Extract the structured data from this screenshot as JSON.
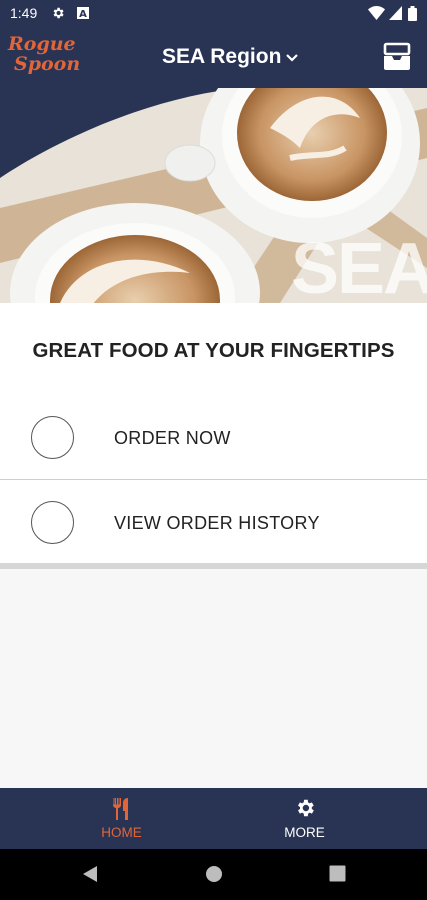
{
  "status_bar": {
    "time": "1:49",
    "icons": [
      "settings-icon",
      "text-a-icon",
      "wifi-icon",
      "signal-icon",
      "battery-icon"
    ]
  },
  "header": {
    "logo_line1": "Rogue",
    "logo_line2": "Spoon",
    "region": "SEA Region",
    "region_icon": "chevron-down-icon",
    "right_icon": "inbox-tray-icon"
  },
  "hero": {
    "overlay_text": "SEA"
  },
  "main": {
    "headline": "GREAT FOOD AT YOUR FINGERTIPS",
    "options": [
      {
        "label": "ORDER NOW"
      },
      {
        "label": "VIEW ORDER HISTORY"
      }
    ]
  },
  "bottom_nav": {
    "items": [
      {
        "label": "HOME",
        "icon": "fork-knife-icon",
        "active": true
      },
      {
        "label": "MORE",
        "icon": "gear-icon",
        "active": false
      }
    ]
  },
  "colors": {
    "navy": "#293353",
    "accent": "#e0663a",
    "white": "#ffffff"
  }
}
